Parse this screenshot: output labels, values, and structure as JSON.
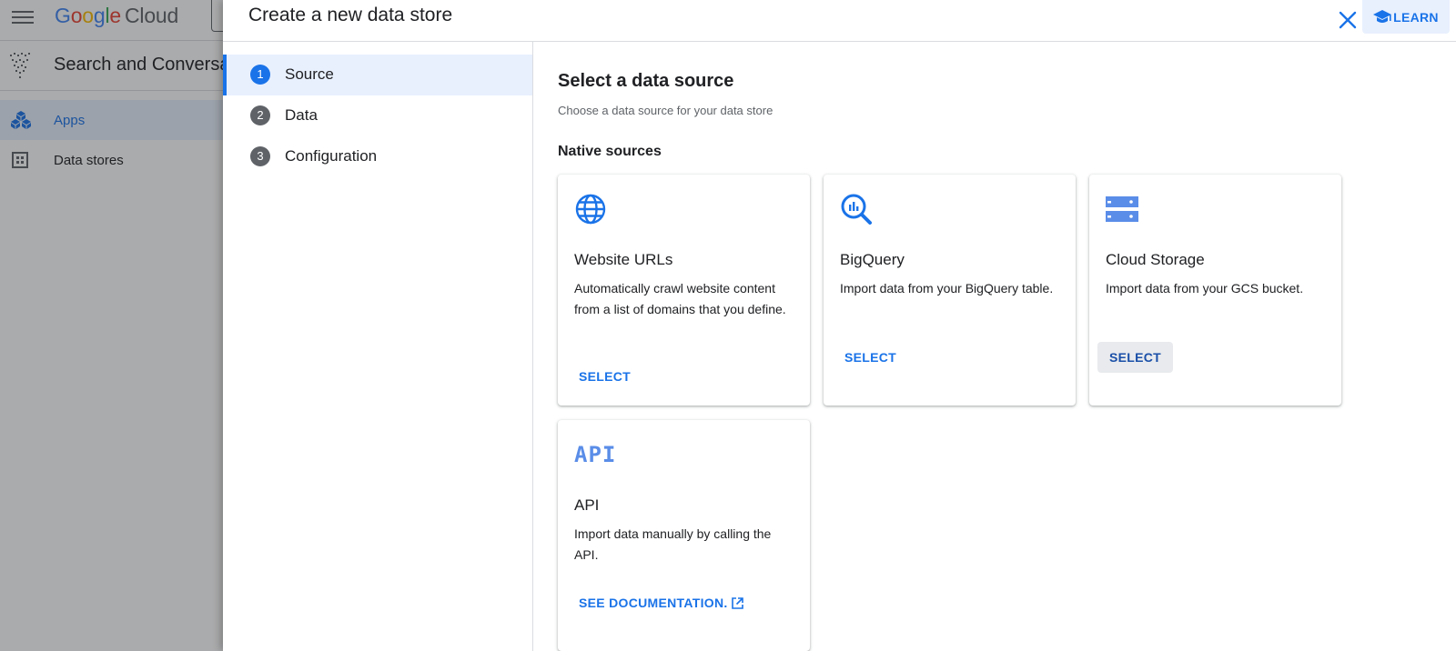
{
  "background": {
    "logo": {
      "google": "Google",
      "cloud": "Cloud"
    },
    "product_title": "Search and Conversation",
    "nav": [
      {
        "label": "Apps",
        "icon": "apps-cube-icon"
      },
      {
        "label": "Data stores",
        "icon": "data-stores-icon"
      }
    ]
  },
  "panel": {
    "title": "Create a new data store",
    "learn_label": "LEARN",
    "steps": [
      {
        "number": "1",
        "label": "Source",
        "active": true
      },
      {
        "number": "2",
        "label": "Data",
        "active": false
      },
      {
        "number": "3",
        "label": "Configuration",
        "active": false
      }
    ],
    "heading": "Select a data source",
    "subheading": "Choose a data source for your data store",
    "section_title": "Native sources",
    "cards": [
      {
        "icon": "globe-icon",
        "title": "Website URLs",
        "description": "Automatically crawl website content from a list of domains that you define.",
        "button": "SELECT"
      },
      {
        "icon": "bigquery-icon",
        "title": "BigQuery",
        "description": "Import data from your BigQuery table.",
        "button": "SELECT"
      },
      {
        "icon": "cloud-storage-icon",
        "title": "Cloud Storage",
        "description": "Import data from your GCS bucket.",
        "button": "SELECT"
      },
      {
        "icon": "api-icon",
        "icon_text": "API",
        "title": "API",
        "description": "Import data manually by calling the API.",
        "button": "SEE DOCUMENTATION."
      }
    ]
  },
  "colors": {
    "accent": "#1a73e8",
    "scrim": "#8a8b8d",
    "hover_button": "#e8eaed"
  }
}
